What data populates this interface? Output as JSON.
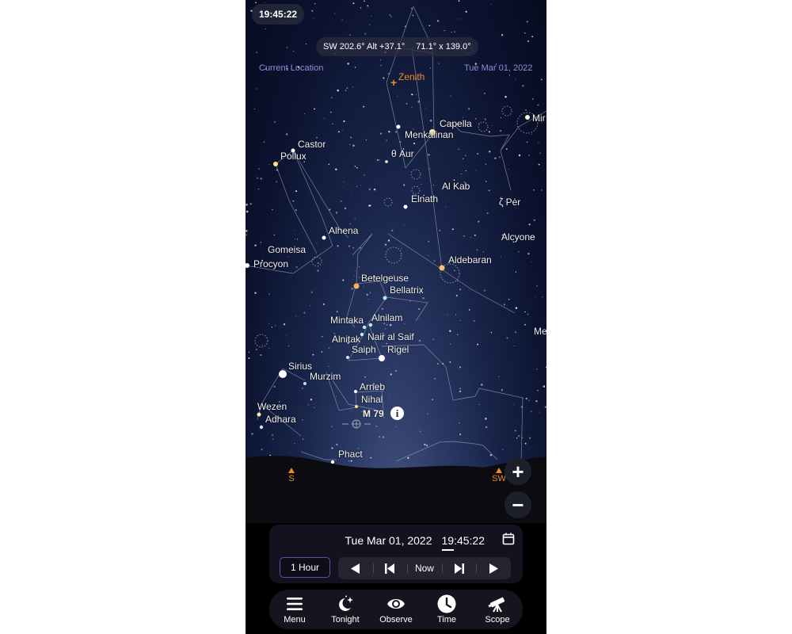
{
  "header": {
    "time": "19:45:22",
    "direction": "SW 202.6° Alt +37.1°",
    "fov": "71.1° x 139.0°",
    "location": "Current Location",
    "date": "Tue Mar 01, 2022"
  },
  "sky": {
    "zenith_label": "Zenith",
    "compass": [
      {
        "label": "S"
      },
      {
        "label": "SW"
      }
    ],
    "star_labels": [
      "Capella",
      "Menkalinan",
      "Castor",
      "Pollux",
      "θ Aur",
      "Al Kab",
      "Elnath",
      "ζ Per",
      "Mir",
      "Alhena",
      "Alcyone",
      "Gomeisa",
      "Procyon",
      "Aldebaran",
      "Betelgeuse",
      "Bellatrix",
      "Mintaka",
      "Alnilam",
      "Me",
      "Alnitak",
      "Nair al Saif",
      "Saiph",
      "Rigel",
      "Sirius",
      "Murzim",
      "Arneb",
      "Nihal",
      "Wezen",
      "Adhara",
      "M 79",
      "Phact"
    ],
    "selected_object": "M 79"
  },
  "zoom_controls": {
    "zoom_in": "+",
    "zoom_out": "−"
  },
  "time_panel": {
    "date": "Tue Mar 01, 2022",
    "time": "19:45:22",
    "step": "1 Hour",
    "controls": [
      {
        "name": "step-back",
        "icon": "play-reverse-icon"
      },
      {
        "name": "skip-back",
        "icon": "skip-back-icon"
      },
      {
        "name": "now",
        "label": "Now"
      },
      {
        "name": "skip-forward",
        "icon": "skip-forward-icon"
      },
      {
        "name": "step-forward",
        "icon": "play-icon"
      }
    ]
  },
  "tabbar": {
    "items": [
      {
        "label": "Menu",
        "icon": "menu-icon"
      },
      {
        "label": "Tonight",
        "icon": "moon-stars-icon"
      },
      {
        "label": "Observe",
        "icon": "eye-icon"
      },
      {
        "label": "Time",
        "icon": "clock-icon",
        "active": true
      },
      {
        "label": "Scope",
        "icon": "telescope-icon"
      }
    ]
  },
  "colors": {
    "accent_orange": "#f08a2c",
    "overlay_text": "#8f8fd8",
    "step_border": "#5b4fa8"
  }
}
